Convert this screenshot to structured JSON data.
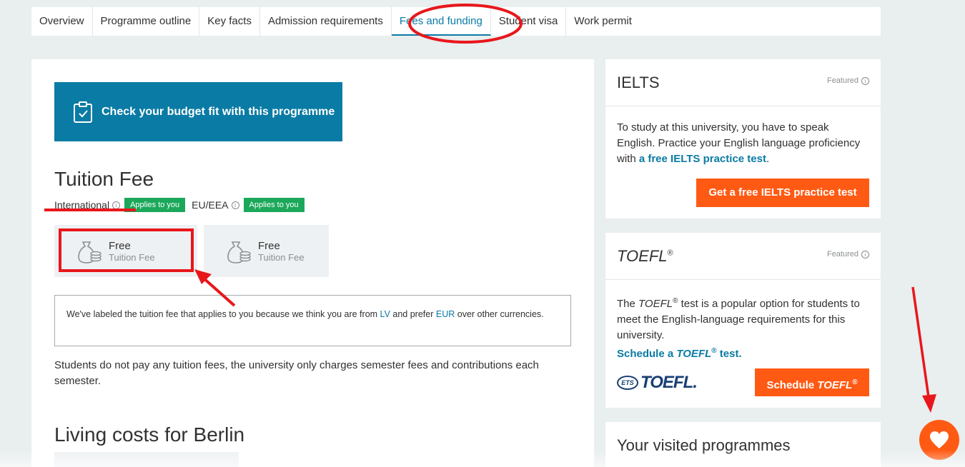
{
  "tabs": [
    "Overview",
    "Programme outline",
    "Key facts",
    "Admission requirements",
    "Fees and funding",
    "Student visa",
    "Work permit"
  ],
  "main": {
    "budget_button": "Check your budget fit with this programme",
    "tuition_heading": "Tuition Fee",
    "international_label": "International",
    "eu_label": "EU/EEA",
    "applies_badge": "Applies to you",
    "fee_international": {
      "amount": "Free",
      "unit": "Tuition Fee"
    },
    "fee_eu": {
      "amount": "Free",
      "unit": "Tuition Fee"
    },
    "note": {
      "part1": "We've labeled the tuition fee that applies to you because we think you are from ",
      "country": "LV",
      "part2": " and prefer ",
      "currency": "EUR",
      "part3": " over other currencies."
    },
    "description": "Students do not pay any tuition fees, the university only charges semester fees and contributions each semester.",
    "living_heading": "Living costs for Berlin"
  },
  "sidebar": {
    "featured": "Featured",
    "ielts": {
      "title": "IELTS",
      "text": "To study at this university, you have to speak English. Practice your English language proficiency with ",
      "link": "a free IELTS practice test",
      "after": ".",
      "button": "Get a free IELTS practice test"
    },
    "toefl": {
      "title": "TOEFL",
      "sup": "®",
      "text_pre": "The ",
      "text_post": " test is a popular option for students to meet the English-language requirements for this university.",
      "link_pre": "Schedule a ",
      "link_post": " test.",
      "button_pre": "Schedule ",
      "logo_ets": "ETS",
      "logo_word": "TOEFL."
    },
    "visited": {
      "title": "Your visited programmes"
    }
  },
  "colors": {
    "accent": "#0a7ba4",
    "orange": "#ff5a14",
    "green": "#1ba85a",
    "annotation": "#e8171b"
  }
}
